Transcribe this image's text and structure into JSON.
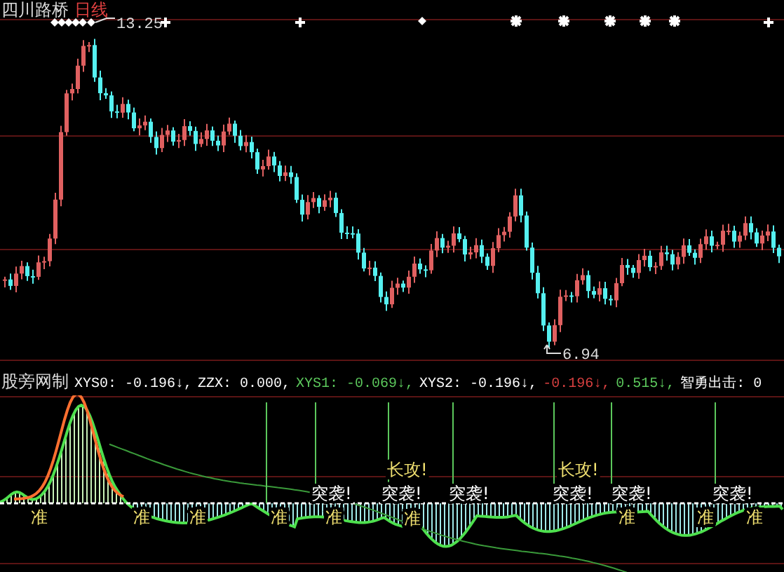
{
  "title": {
    "stock_name": "四川路桥",
    "period": "日线"
  },
  "price_chart": {
    "high_label": "13.25",
    "low_label": "6.94"
  },
  "indicator": {
    "name": "股旁网制",
    "readouts": [
      {
        "text": "XYS0: -0.196↓,",
        "color": "#ffffff"
      },
      {
        "text": "ZZX: 0.000,",
        "color": "#ffffff"
      },
      {
        "text": "XYS1: -0.069↓,",
        "color": "#5cc85c"
      },
      {
        "text": "XYS2: -0.196↓,",
        "color": "#ffffff"
      },
      {
        "text": "-0.196↓,",
        "color": "#d84040"
      },
      {
        "text": "0.515↓,",
        "color": "#5cc85c"
      },
      {
        "text": "智勇出击: 0",
        "color": "#ffffff"
      }
    ]
  },
  "signals": [
    {
      "kind": "zhun",
      "text": "准"
    },
    {
      "kind": "zhun",
      "text": "准"
    },
    {
      "kind": "zhun",
      "text": "准"
    },
    {
      "kind": "zhun",
      "text": "准"
    },
    {
      "kind": "tuxi",
      "text": "突袭!"
    },
    {
      "kind": "zhun",
      "text": "准"
    },
    {
      "kind": "changgong",
      "text": "长攻!"
    },
    {
      "kind": "tuxi",
      "text": "突袭!"
    },
    {
      "kind": "zhun",
      "text": "准"
    },
    {
      "kind": "tuxi",
      "text": "突袭!"
    },
    {
      "kind": "changgong",
      "text": "长攻!"
    },
    {
      "kind": "tuxi",
      "text": "突袭!"
    },
    {
      "kind": "tuxi",
      "text": "突袭!"
    },
    {
      "kind": "zhun",
      "text": "准"
    },
    {
      "kind": "zhun",
      "text": "准"
    },
    {
      "kind": "tuxi",
      "text": "突袭!"
    },
    {
      "kind": "zhun",
      "text": "准"
    }
  ]
}
